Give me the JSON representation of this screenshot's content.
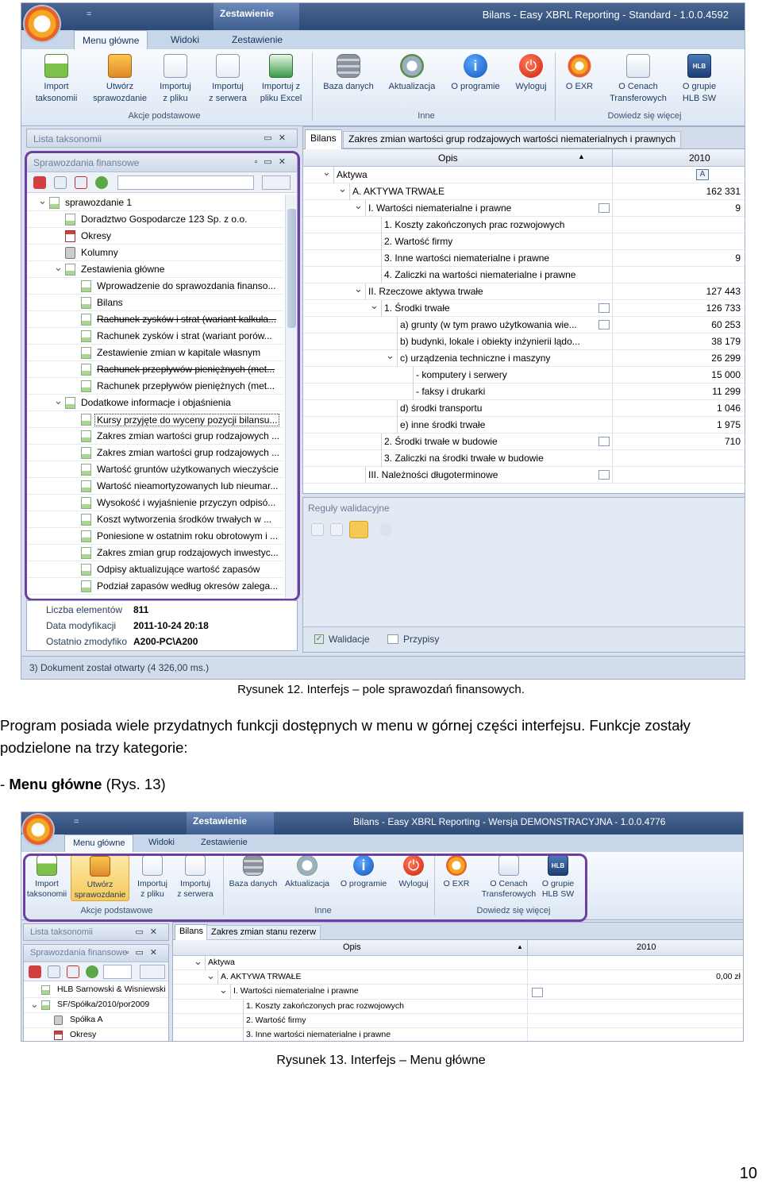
{
  "fig12": {
    "qat": "=",
    "context_tab": "Zestawienie",
    "title": "Bilans - Easy XBRL Reporting - Standard - 1.0.0.4592",
    "tabs": [
      "Menu główne",
      "Widoki",
      "Zestawienie"
    ],
    "ribbon": {
      "buttons": [
        {
          "l1": "Import",
          "l2": "taksonomii",
          "icon": "import-taxonomy-icon"
        },
        {
          "l1": "Utwórz",
          "l2": "sprawozdanie",
          "icon": "create-report-icon"
        },
        {
          "l1": "Importuj",
          "l2": "z pliku",
          "icon": "import-file-icon"
        },
        {
          "l1": "Importuj",
          "l2": "z serwera",
          "icon": "import-server-icon"
        },
        {
          "l1": "Importuj z",
          "l2": "pliku Excel",
          "icon": "import-excel-icon"
        },
        {
          "l1": "Baza danych",
          "l2": "",
          "icon": "database-icon"
        },
        {
          "l1": "Aktualizacja",
          "l2": "",
          "icon": "update-icon"
        },
        {
          "l1": "O programie",
          "l2": "",
          "icon": "info-icon"
        },
        {
          "l1": "Wyloguj",
          "l2": "",
          "icon": "power-icon"
        },
        {
          "l1": "O EXR",
          "l2": "",
          "icon": "exr-logo-icon"
        },
        {
          "l1": "O Cenach",
          "l2": "Transferowych",
          "icon": "transfer-pricing-icon"
        },
        {
          "l1": "O grupie",
          "l2": "HLB SW",
          "icon": "hlb-logo-icon"
        }
      ],
      "groups": [
        "Akcje podstawowe",
        "Inne",
        "Dowiedz się więcej"
      ],
      "info_glyph": "i",
      "power_glyph": "⏻",
      "hlb_glyph": "HLB"
    },
    "left_panel_title": "Lista taksonomii",
    "fin_panel_title": "Sprawozdania finansowe",
    "tree": [
      {
        "text": "sprawozdanie 1",
        "indent": 0,
        "exp": "v",
        "icon": "doc"
      },
      {
        "text": "Doradztwo Gospodarcze 123 Sp. z o.o.",
        "indent": 1,
        "exp": "",
        "icon": "doc"
      },
      {
        "text": "Okresy",
        "indent": 1,
        "exp": "",
        "icon": "cal"
      },
      {
        "text": "Kolumny",
        "indent": 1,
        "exp": "",
        "icon": "cube"
      },
      {
        "text": "Zestawienia główne",
        "indent": 1,
        "exp": "v",
        "icon": "folder"
      },
      {
        "text": "Wprowadzenie do sprawozdania finanso...",
        "indent": 2,
        "exp": "",
        "icon": "doc"
      },
      {
        "text": "Bilans",
        "indent": 2,
        "exp": "",
        "icon": "doc"
      },
      {
        "text": "Rachunek zysków i strat (wariant kalkula...",
        "indent": 2,
        "exp": "",
        "icon": "doc",
        "strike": true
      },
      {
        "text": "Rachunek zysków i strat (wariant porów...",
        "indent": 2,
        "exp": "",
        "icon": "doc"
      },
      {
        "text": "Zestawienie zmian w kapitale własnym",
        "indent": 2,
        "exp": "",
        "icon": "doc"
      },
      {
        "text": "Rachunek przepływów pieniężnych (met...",
        "indent": 2,
        "exp": "",
        "icon": "doc",
        "strike": true
      },
      {
        "text": "Rachunek przepływów pieniężnych (met...",
        "indent": 2,
        "exp": "",
        "icon": "doc"
      },
      {
        "text": "Dodatkowe informacje i objaśnienia",
        "indent": 1,
        "exp": "v",
        "icon": "folder"
      },
      {
        "text": "Kursy przyjęte do wyceny pozycji bilansu...",
        "indent": 2,
        "exp": "",
        "icon": "doc",
        "selected": true
      },
      {
        "text": "Zakres zmian wartości grup rodzajowych ...",
        "indent": 2,
        "exp": "",
        "icon": "doc"
      },
      {
        "text": "Zakres zmian wartości grup rodzajowych ...",
        "indent": 2,
        "exp": "",
        "icon": "doc"
      },
      {
        "text": "Wartość gruntów użytkowanych wieczyście",
        "indent": 2,
        "exp": "",
        "icon": "doc"
      },
      {
        "text": "Wartość nieamortyzowanych lub nieumar...",
        "indent": 2,
        "exp": "",
        "icon": "doc"
      },
      {
        "text": "Wysokość i wyjaśnienie przyczyn odpisó...",
        "indent": 2,
        "exp": "",
        "icon": "doc"
      },
      {
        "text": "Koszt wytworzenia środków trwałych w ...",
        "indent": 2,
        "exp": "",
        "icon": "doc"
      },
      {
        "text": "Poniesione w ostatnim roku obrotowym i ...",
        "indent": 2,
        "exp": "",
        "icon": "doc"
      },
      {
        "text": "Zakres zmian grup rodzajowych inwestyc...",
        "indent": 2,
        "exp": "",
        "icon": "doc"
      },
      {
        "text": "Odpisy aktualizujące wartość zapasów",
        "indent": 2,
        "exp": "",
        "icon": "doc"
      },
      {
        "text": "Podział zapasów według okresów zalega...",
        "indent": 2,
        "exp": "",
        "icon": "doc"
      }
    ],
    "props": [
      {
        "label": "Liczba elementów",
        "value": "811"
      },
      {
        "label": "Data modyfikacji",
        "value": "2011-10-24 20:18"
      },
      {
        "label": "Ostatnio zmodyfiko",
        "value": "A200-PC\\A200"
      }
    ],
    "status": "3) Dokument został otwarty (4 326,00 ms.)",
    "doc_tabs": [
      "Bilans",
      "Zakres zmian wartości grup rodzajowych wartości niematerialnych i prawnych"
    ],
    "grid_header": {
      "col1": "Opis",
      "col2": "2010",
      "sort": "▲"
    },
    "grid": [
      {
        "text": "Aktywa",
        "indent": 0,
        "exp": "v",
        "value": "",
        "note": false,
        "marker": true
      },
      {
        "text": "A. AKTYWA TRWAŁE",
        "indent": 1,
        "exp": "v",
        "value": "162 331",
        "note": false
      },
      {
        "text": "I. Wartości niematerialne i prawne",
        "indent": 2,
        "exp": "v",
        "value": "9",
        "note": true
      },
      {
        "text": "1. Koszty zakończonych prac rozwojowych",
        "indent": 3,
        "exp": "",
        "value": "",
        "note": false
      },
      {
        "text": "2. Wartość firmy",
        "indent": 3,
        "exp": "",
        "value": "",
        "note": false
      },
      {
        "text": "3. Inne wartości niematerialne i prawne",
        "indent": 3,
        "exp": "",
        "value": "9",
        "note": false
      },
      {
        "text": "4. Zaliczki na wartości niematerialne i prawne",
        "indent": 3,
        "exp": "",
        "value": "",
        "note": false
      },
      {
        "text": "II. Rzeczowe aktywa trwałe",
        "indent": 2,
        "exp": "v",
        "value": "127 443",
        "note": false
      },
      {
        "text": "1. Środki trwałe",
        "indent": 3,
        "exp": "v",
        "value": "126 733",
        "note": true
      },
      {
        "text": "a) grunty (w tym prawo użytkowania wie...",
        "indent": 4,
        "exp": "",
        "value": "60 253",
        "note": true
      },
      {
        "text": "b) budynki, lokale i obiekty inżynierii lądo...",
        "indent": 4,
        "exp": "",
        "value": "38 179",
        "note": false
      },
      {
        "text": "c) urządzenia techniczne i maszyny",
        "indent": 4,
        "exp": "v",
        "value": "26 299",
        "note": false
      },
      {
        "text": "- komputery i serwery",
        "indent": 5,
        "exp": "",
        "value": "15 000",
        "note": false
      },
      {
        "text": "- faksy i drukarki",
        "indent": 5,
        "exp": "",
        "value": "11 299",
        "note": false
      },
      {
        "text": "d) środki transportu",
        "indent": 4,
        "exp": "",
        "value": "1 046",
        "note": false
      },
      {
        "text": "e) inne środki trwałe",
        "indent": 4,
        "exp": "",
        "value": "1 975",
        "note": false
      },
      {
        "text": "2. Środki trwałe w budowie",
        "indent": 3,
        "exp": "",
        "value": "710",
        "note": true
      },
      {
        "text": "3. Zaliczki na środki trwałe w budowie",
        "indent": 3,
        "exp": "",
        "value": "",
        "note": false
      },
      {
        "text": "III. Należności długoterminowe",
        "indent": 2,
        "exp": "",
        "value": "",
        "note": true
      }
    ],
    "validation_title": "Reguły walidacyjne",
    "bottom_tabs": [
      "Walidacje",
      "Przypisy"
    ],
    "marker_glyph": "A"
  },
  "caption12": "Rysunek 12. Interfejs – pole sprawozdań finansowych.",
  "paragraph": "Program posiada wiele przydatnych funkcji dostępnych w menu w górnej części interfejsu. Funkcje zostały podzielone na trzy kategorie:",
  "menu_line": {
    "dash": "- ",
    "bold": "Menu główne",
    "rest": " (Rys. 13)"
  },
  "fig13": {
    "qat": "=",
    "context_tab": "Zestawienie",
    "title": "Bilans - Easy XBRL Reporting - Wersja DEMONSTRACYJNA - 1.0.0.4776",
    "tabs": [
      "Menu główne",
      "Widoki",
      "Zestawienie"
    ],
    "buttons": [
      {
        "l1": "Import",
        "l2": "taksonomii"
      },
      {
        "l1": "Utwórz",
        "l2": "sprawozdanie"
      },
      {
        "l1": "Importuj",
        "l2": "z pliku"
      },
      {
        "l1": "Importuj",
        "l2": "z serwera"
      },
      {
        "l1": "Baza danych",
        "l2": ""
      },
      {
        "l1": "Aktualizacja",
        "l2": ""
      },
      {
        "l1": "O programie",
        "l2": ""
      },
      {
        "l1": "Wyloguj",
        "l2": ""
      },
      {
        "l1": "O EXR",
        "l2": ""
      },
      {
        "l1": "O Cenach",
        "l2": "Transferowych"
      },
      {
        "l1": "O grupie",
        "l2": "HLB SW"
      }
    ],
    "groups": [
      "Akcje podstawowe",
      "Inne",
      "Dowiedz się więcej"
    ],
    "left_panel_title": "Lista taksonomii",
    "fin_panel_title": "Sprawozdania finansowe",
    "tree": [
      {
        "text": "HLB Sarnowski & Wisniewski",
        "indent": 0,
        "exp": "",
        "icon": "doc"
      },
      {
        "text": "SF/Spółka/2010/por2009",
        "indent": 0,
        "exp": "v",
        "icon": "doc"
      },
      {
        "text": "Spółka A",
        "indent": 1,
        "exp": "",
        "icon": "cube"
      },
      {
        "text": "Okresy",
        "indent": 1,
        "exp": "",
        "icon": "cal"
      }
    ],
    "doc_tabs": [
      "Bilans",
      "Zakres zmian stanu rezerw"
    ],
    "grid_header": {
      "col1": "Opis",
      "col2": "2010",
      "sort": "▲"
    },
    "grid": [
      {
        "text": "Aktywa",
        "indent": 0,
        "exp": "v",
        "value": "",
        "note": false
      },
      {
        "text": "A. AKTYWA TRWAŁE",
        "indent": 1,
        "exp": "v",
        "value": "0,00 zł",
        "note": false
      },
      {
        "text": "I. Wartości niematerialne i prawne",
        "indent": 2,
        "exp": "v",
        "value": "",
        "note": true
      },
      {
        "text": "1. Koszty zakończonych prac rozwojowych",
        "indent": 3,
        "exp": "",
        "value": "",
        "note": false
      },
      {
        "text": "2. Wartość firmy",
        "indent": 3,
        "exp": "",
        "value": "",
        "note": false
      },
      {
        "text": "3. Inne wartości niematerialne i prawne",
        "indent": 3,
        "exp": "",
        "value": "",
        "note": false
      }
    ]
  },
  "caption13": "Rysunek 13. Interfejs – Menu główne",
  "page_number": "10"
}
